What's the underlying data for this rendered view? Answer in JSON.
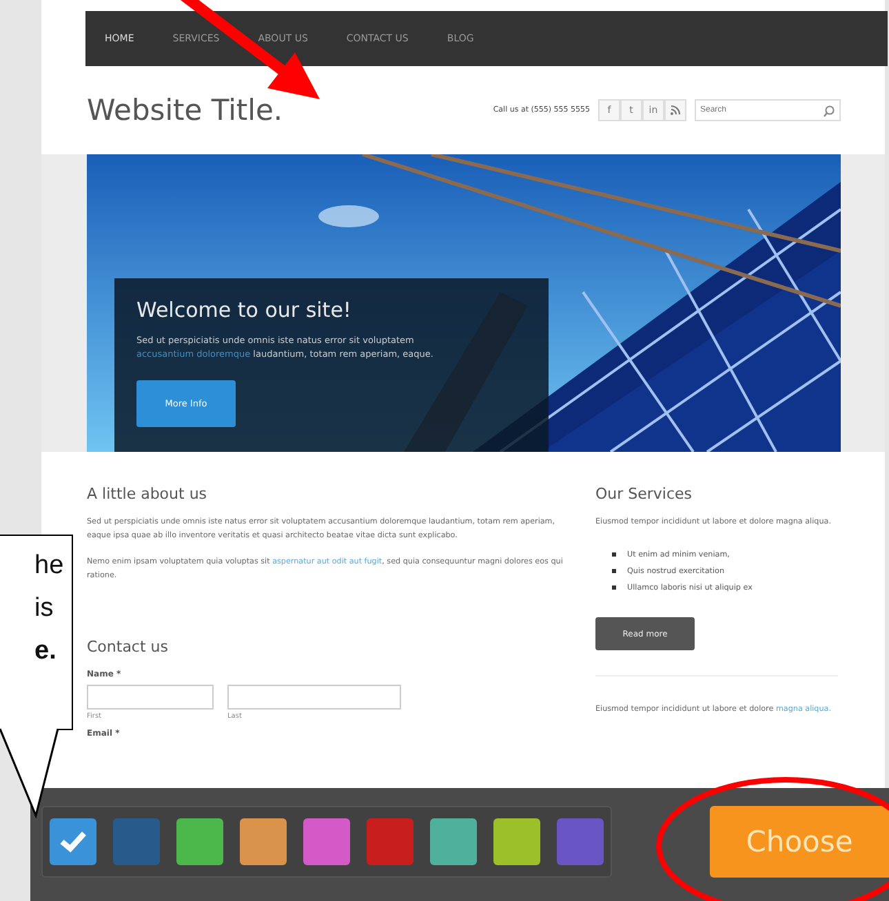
{
  "nav": {
    "items": [
      {
        "label": "HOME",
        "selected": true
      },
      {
        "label": "SERVICES",
        "selected": false
      },
      {
        "label": "ABOUT US",
        "selected": false
      },
      {
        "label": "CONTACT US",
        "selected": false
      },
      {
        "label": "BLOG",
        "selected": false
      }
    ]
  },
  "header": {
    "title": "Website Title.",
    "phone": "Call us at (555) 555 5555",
    "social_buttons": [
      {
        "kind": "letter",
        "label": "f"
      },
      {
        "kind": "letter",
        "label": "t"
      },
      {
        "kind": "letter",
        "label": "in"
      },
      {
        "kind": "feed"
      }
    ],
    "search": {
      "placeholder": "Search"
    }
  },
  "hero": {
    "kind": "picture",
    "heading": "Welcome to our site!",
    "text": "Sed ut perspiciatis unde omnis iste natus error sit voluptatem",
    "link": "accusantium doloremque",
    "text_after": "laudantium, totam rem aperiam, eaque.",
    "button": "More Info"
  },
  "about": {
    "heading": "A little about us",
    "paragraph": "Sed ut perspiciatis unde omnis iste natus error sit voluptatem accusantium doloremque laudantium, totam rem aperiam, eaque ipsa quae ab illo inventore veritatis et quasi architecto beatae vitae dicta sunt explicabo.",
    "paragraph_2": "Nemo enim ipsam voluptatem quia voluptas sit",
    "link": "aspernatur aut odit aut fugit",
    "paragraph_2_after": ", sed quia consequuntur magni dolores eos qui ratione."
  },
  "contact": {
    "heading": "Contact us",
    "name_label": "Name *",
    "fields": [
      {
        "caption": "First"
      },
      {
        "caption": "Last"
      }
    ],
    "email_label": "Email *"
  },
  "services": {
    "heading": "Our Services",
    "text": "Eiusmod tempor incididunt ut labore et dolore magna aliqua.",
    "items": [
      "Ut enim ad minim veniam,",
      "Quis nostrud exercitation",
      "Ullamco laboris nisi ut aliquip ex"
    ],
    "button": "Read more",
    "text_2": "Eiusmod tempor incididunt ut labore et dolore",
    "link_2": "magna aliqua."
  },
  "palette": {
    "swatches": [
      {
        "color": "#3a93d8",
        "selected": true
      },
      {
        "color": "#285a8c",
        "selected": false
      },
      {
        "color": "#4cb84c",
        "selected": false
      },
      {
        "color": "#d9934a",
        "selected": false
      },
      {
        "color": "#d45ac8",
        "selected": false
      },
      {
        "color": "#c81e1e",
        "selected": false
      },
      {
        "color": "#4fb09c",
        "selected": false
      },
      {
        "color": "#9cc02a",
        "selected": false
      },
      {
        "color": "#6a55c4",
        "selected": false
      }
    ],
    "button": "Choose"
  },
  "callout": {
    "lines": [
      {
        "text": "he",
        "bold": false
      },
      {
        "text": "is",
        "bold": false
      },
      {
        "text": "e.",
        "bold": true
      }
    ]
  }
}
